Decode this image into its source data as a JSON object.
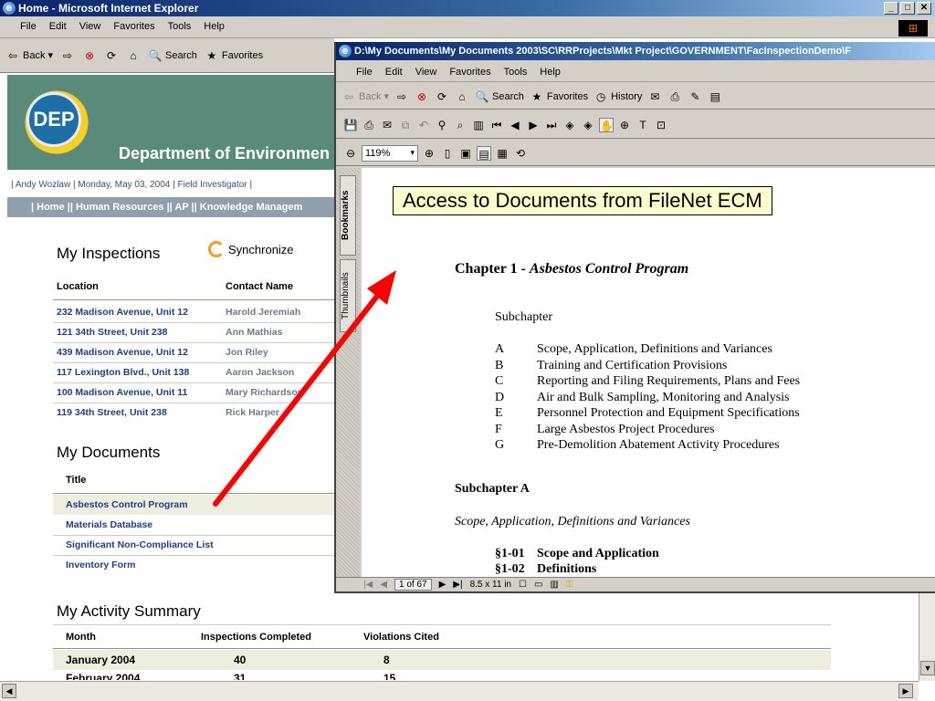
{
  "ie_window": {
    "title": "Home - Microsoft Internet Explorer",
    "menu": [
      "File",
      "Edit",
      "View",
      "Favorites",
      "Tools",
      "Help"
    ],
    "toolbar": {
      "back": "Back",
      "search": "Search",
      "favorites": "Favorites"
    }
  },
  "site": {
    "logo_text": "DEP",
    "department": "Department of Environmen",
    "status_line": "| Andy Wozlaw | Monday, May 03, 2004 |   Field Investigator |",
    "nav_line": "| Home || Human Resources || AP || Knowledge Managem",
    "inspections": {
      "title": "My Inspections",
      "sync_label": "Synchronize",
      "headers": [
        "Location",
        "Contact Name"
      ],
      "rows": [
        {
          "location": "232 Madison Avenue, Unit 12",
          "contact": "Harold Jeremiah"
        },
        {
          "location": "121 34th Street, Unit 238",
          "contact": "Ann Mathias"
        },
        {
          "location": "439 Madison Avenue, Unit 12",
          "contact": "Jon Riley"
        },
        {
          "location": "117 Lexington Blvd., Unit 138",
          "contact": "Aaron Jackson"
        },
        {
          "location": "100 Madison Avenue, Unit 11",
          "contact": "Mary Richardson"
        },
        {
          "location": "119 34th Street, Unit 238",
          "contact": "Rick Harper"
        }
      ]
    },
    "documents": {
      "title": "My Documents",
      "header": "Title",
      "rows": [
        "Asbestos Control Program",
        "Materials Database",
        "Significant Non-Compliance List",
        "Inventory Form"
      ]
    },
    "activity": {
      "title": "My Activity Summary",
      "headers": [
        "Month",
        "Inspections Completed",
        "Violations Cited"
      ],
      "rows": [
        {
          "month": "January 2004",
          "completed": "40",
          "violations": "8"
        },
        {
          "month": "February 2004",
          "completed": "31",
          "violations": "15"
        }
      ]
    }
  },
  "acrobat_window": {
    "title": "D:\\My Documents\\My Documents 2003\\SC\\RRProjects\\Mkt Project\\GOVERNMENT\\FacInspectionDemo\\F",
    "menu": [
      "File",
      "Edit",
      "View",
      "Favorites",
      "Tools",
      "Help"
    ],
    "toolbar": {
      "back": "Back",
      "search": "Search",
      "favorites": "Favorites",
      "history": "History"
    },
    "zoom": "119%",
    "tabs": {
      "bookmarks": "Bookmarks",
      "thumbnails": "Thumbnails"
    },
    "callout": "Access to Documents from FileNet ECM",
    "document": {
      "chapter_prefix": "Chapter 1 - ",
      "chapter_title": "Asbestos Control Program",
      "subchapter_label": "Subchapter",
      "items": [
        {
          "letter": "A",
          "text": "Scope, Application, Definitions and Variances"
        },
        {
          "letter": "B",
          "text": "Training and Certification Provisions"
        },
        {
          "letter": "C",
          "text": "Reporting and Filing Requirements, Plans and Fees"
        },
        {
          "letter": "D",
          "text": "Air and Bulk Sampling, Monitoring and Analysis"
        },
        {
          "letter": "E",
          "text": "Personnel Protection and Equipment Specifications"
        },
        {
          "letter": "F",
          "text": "Large Asbestos Project Procedures"
        },
        {
          "letter": "G",
          "text": "Pre-Demolition Abatement Activity Procedures"
        }
      ],
      "subchapter_a": "Subchapter A",
      "subchapter_a_title": "Scope, Application, Definitions and Variances",
      "sections": [
        {
          "num": "§1-01",
          "text": "Scope and Application"
        },
        {
          "num": "§1-02",
          "text": "Definitions"
        }
      ]
    },
    "status": {
      "page": "1 of 67",
      "size": "8.5 x 11 in"
    }
  }
}
